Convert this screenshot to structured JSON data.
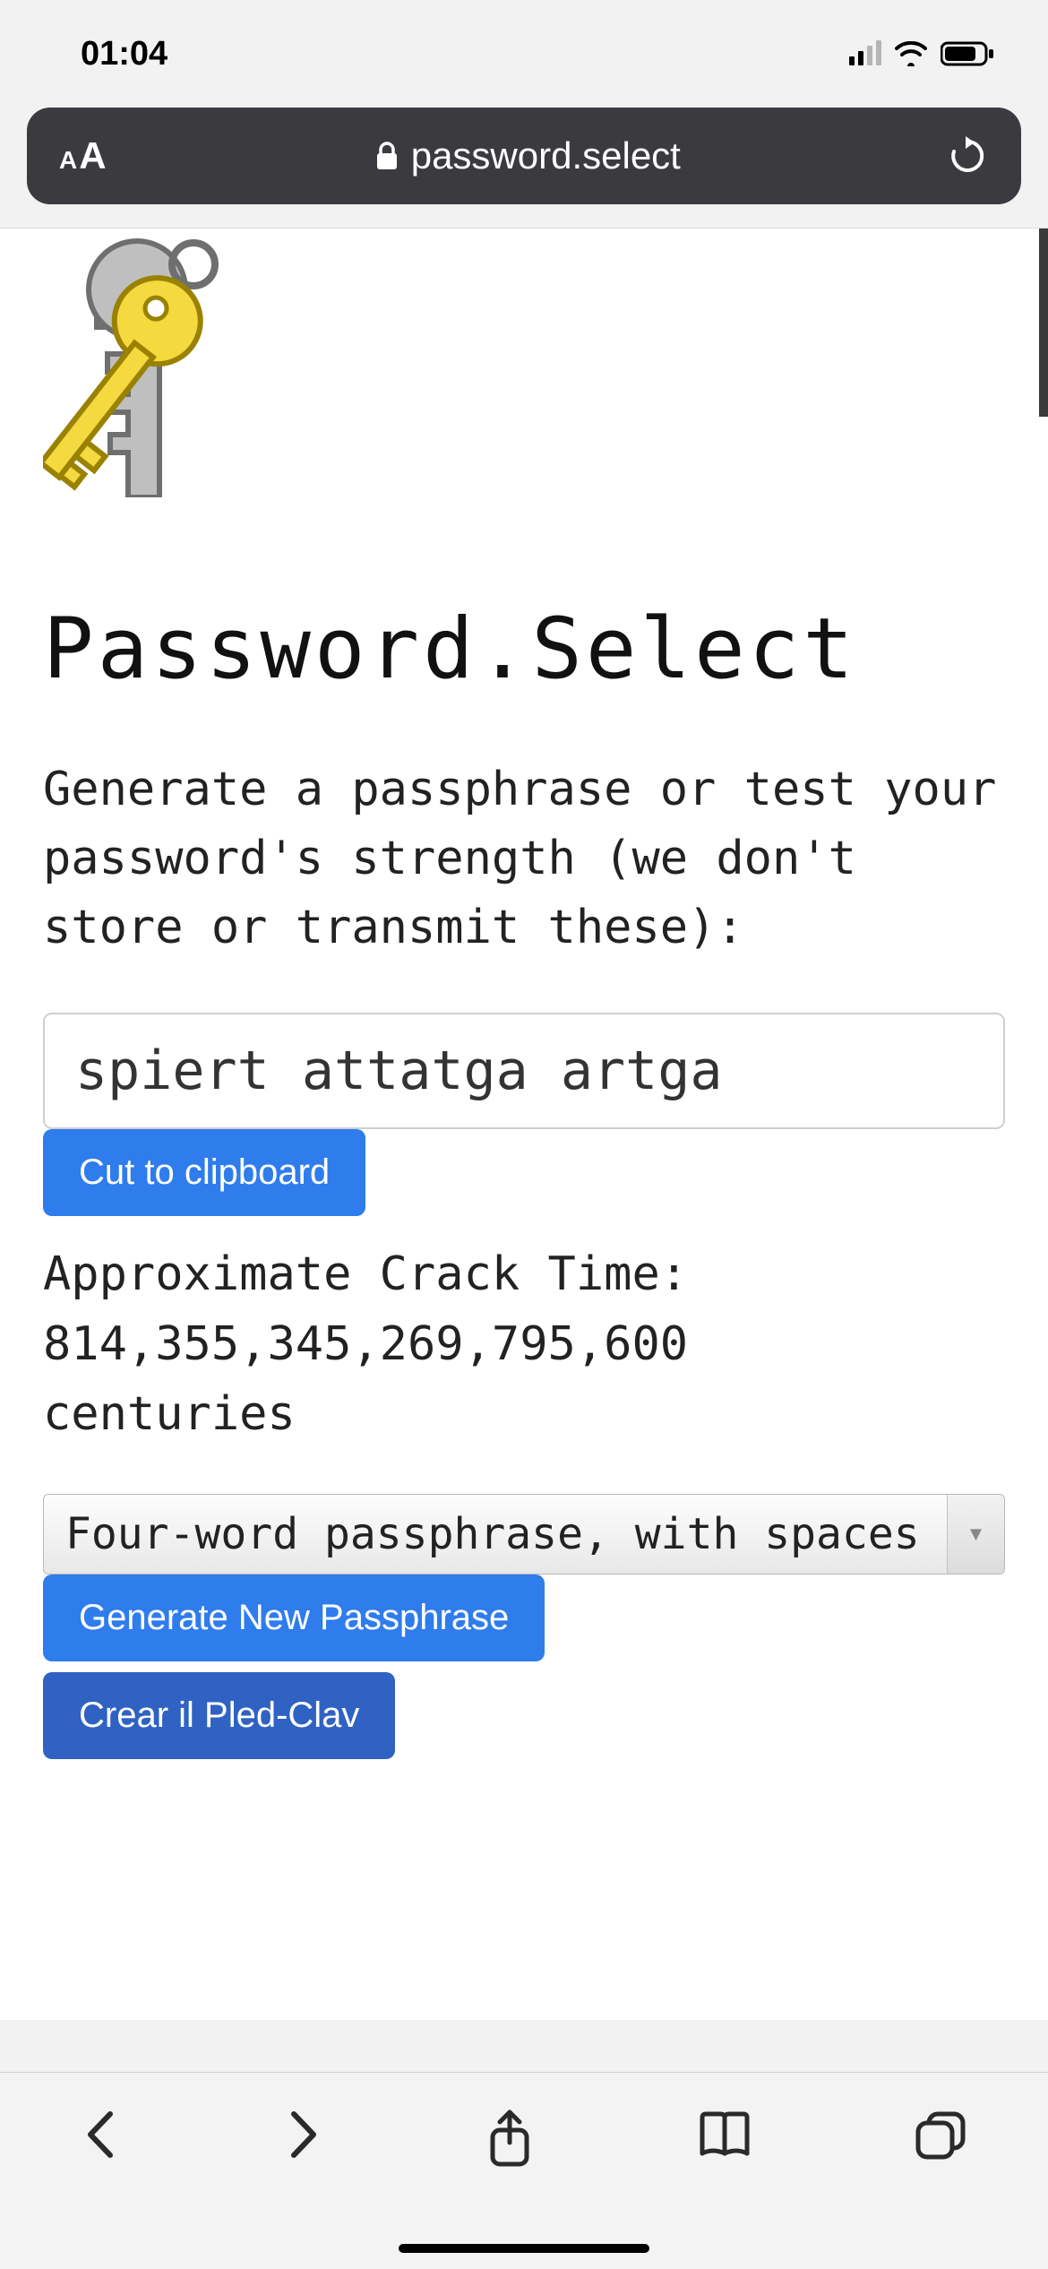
{
  "statusbar": {
    "time": "01:04"
  },
  "urlbar": {
    "domain": "password.select"
  },
  "page": {
    "title": "Password.Select",
    "intro": "Generate a passphrase or test your password's strength (we don't store or transmit these):",
    "password_value": "spiert attatga artga",
    "cut_button": "Cut to clipboard",
    "crack_label": "Approximate Crack Time:",
    "crack_value": "814,355,345,269,795,600",
    "crack_unit": "centuries",
    "select_value": "Four-word passphrase, with spaces",
    "generate_button": "Generate New Passphrase",
    "crear_button": "Crear il Pled-Clav"
  }
}
